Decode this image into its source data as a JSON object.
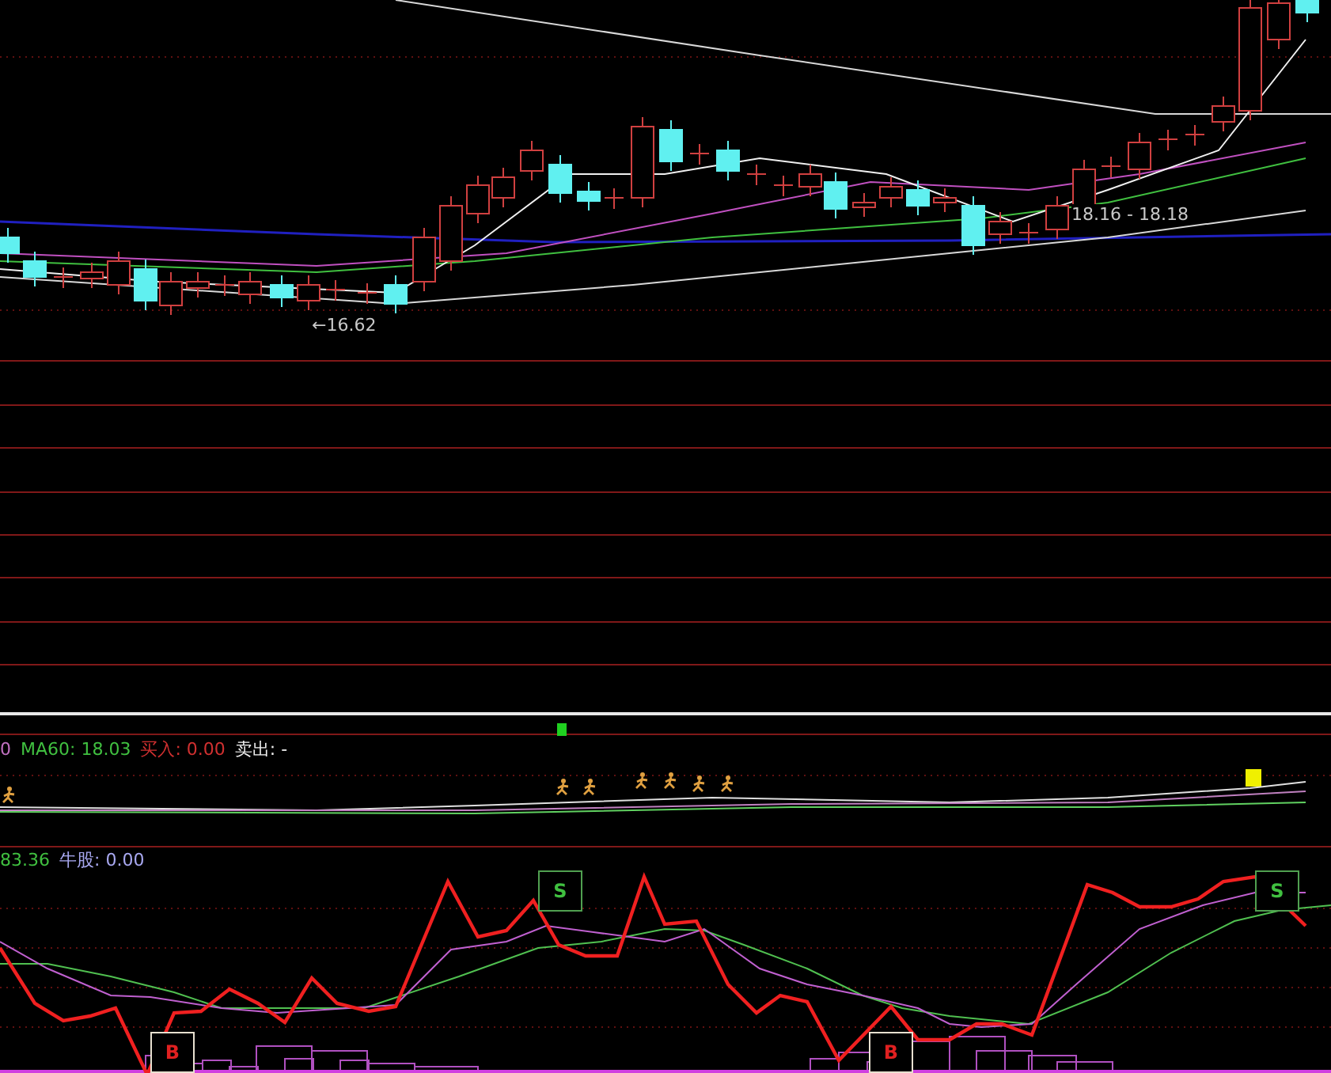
{
  "price_pane": {
    "low_label": "←16.62",
    "range_label": "18.16 - 18.18"
  },
  "signal_pane": {
    "legend": [
      {
        "text": "0",
        "color": "#c070c0"
      },
      {
        "text": "MA60: 18.03",
        "color": "#40c040"
      },
      {
        "text": "买入: 0.00",
        "color": "#d03030"
      },
      {
        "text": "卖出: -",
        "color": "#f0f0f0"
      }
    ]
  },
  "kdj_pane": {
    "legend": [
      {
        "text": "83.36",
        "color": "#40c040"
      },
      {
        "text": "牛股: 0.00",
        "color": "#a8a8f0"
      }
    ],
    "markers": [
      {
        "kind": "sell",
        "label": "S"
      },
      {
        "kind": "sell",
        "label": "S"
      },
      {
        "kind": "buy",
        "label": "B"
      },
      {
        "kind": "buy",
        "label": "B"
      }
    ]
  }
}
